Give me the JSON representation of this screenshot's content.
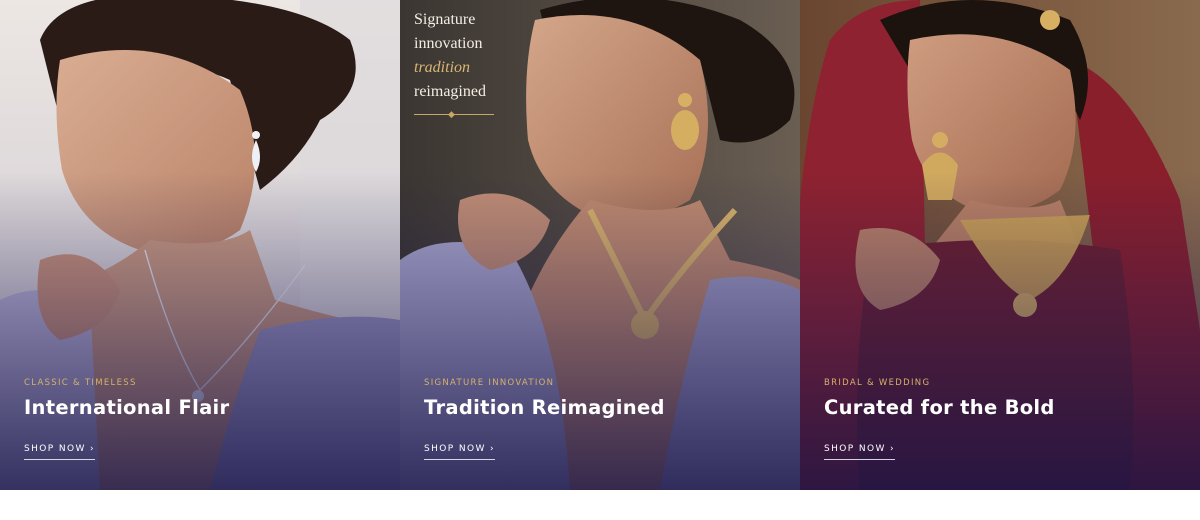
{
  "panels": [
    {
      "eyebrow": "CLASSIC & TIMELESS",
      "title": "International Flair",
      "cta": "SHOP NOW ›",
      "colors": {
        "bg_top": "#e9e3de",
        "bg_bottom": "#c9c4cc",
        "saree": "#8e8cb8",
        "overlay": "#1c184e"
      }
    },
    {
      "eyebrow": "SIGNATURE INNOVATION",
      "title": "Tradition Reimagined",
      "cta": "SHOP NOW ›",
      "colors": {
        "bg_top": "#3a3430",
        "bg_bottom": "#5a5048",
        "saree": "#9a98be",
        "overlay": "#1c184e"
      }
    },
    {
      "eyebrow": "BRIDAL & WEDDING",
      "title": "Curated for the Bold",
      "cta": "SHOP NOW ›",
      "colors": {
        "bg_top": "#5b3a28",
        "bg_bottom": "#3a2420",
        "saree": "#7a1a2a",
        "overlay": "#1c184e"
      }
    }
  ],
  "badge": {
    "line1": "Signature",
    "line2": "innovation",
    "line3": "tradition",
    "line4": "reimagined",
    "ornament": "◆"
  },
  "accent": "#d6b26a"
}
